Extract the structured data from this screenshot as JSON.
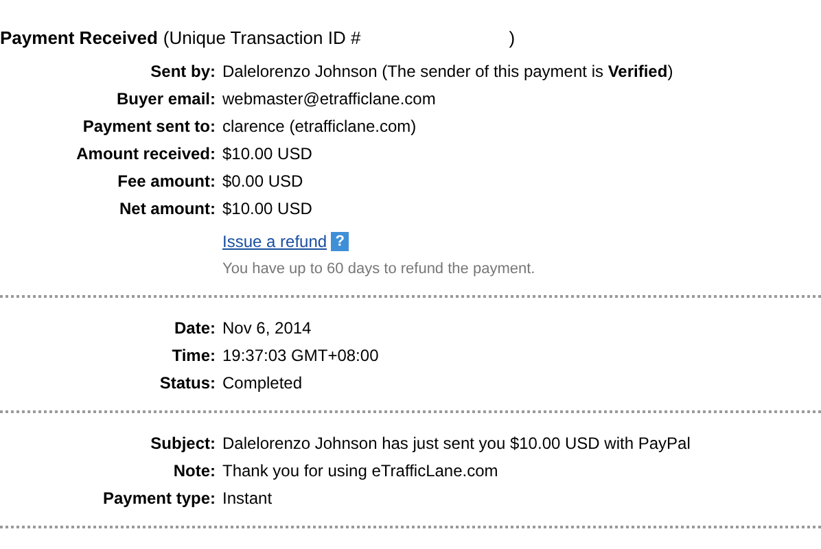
{
  "header": {
    "title": "Payment Received",
    "detail": "(Unique Transaction ID #",
    "closing": ")"
  },
  "sections": [
    {
      "rows": [
        {
          "label": "Sent by:",
          "value": "Dalelorenzo Johnson (The sender of this payment is **Verified**)"
        },
        {
          "label": "Buyer email:",
          "value": "webmaster@etrafficlane.com"
        },
        {
          "label": "Payment sent to:",
          "value": "clarence (etrafficlane.com)"
        },
        {
          "label": "Amount received:",
          "value": "$10.00 USD"
        },
        {
          "label": "Fee amount:",
          "value": "$0.00 USD"
        },
        {
          "label": "Net amount:",
          "value": "$10.00 USD"
        }
      ],
      "refund": {
        "link": "Issue a refund",
        "help": "?",
        "note": "You have up to 60 days to refund the payment."
      }
    },
    {
      "rows": [
        {
          "label": "Date:",
          "value": "Nov 6, 2014"
        },
        {
          "label": "Time:",
          "value": "19:37:03 GMT+08:00"
        },
        {
          "label": "Status:",
          "value": "Completed"
        }
      ]
    },
    {
      "rows": [
        {
          "label": "Subject:",
          "value": "Dalelorenzo Johnson has just sent you $10.00 USD with PayPal"
        },
        {
          "label": "Note:",
          "value": "Thank you for using eTrafficLane.com"
        },
        {
          "label": "Payment type:",
          "value": "Instant"
        }
      ]
    }
  ]
}
